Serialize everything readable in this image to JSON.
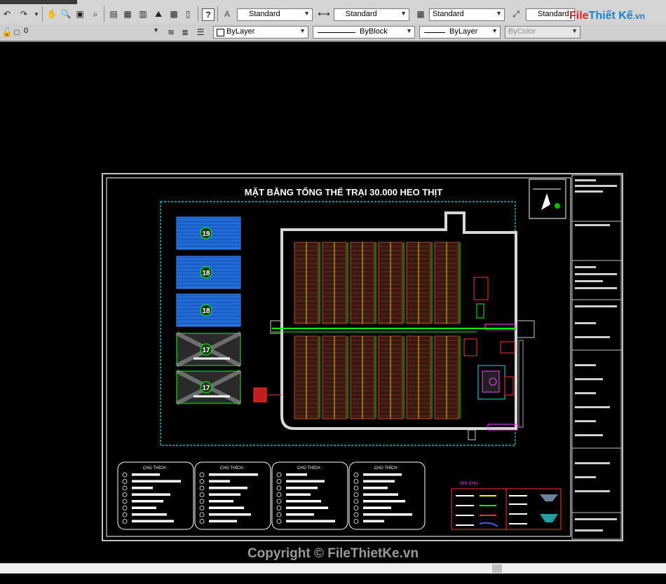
{
  "toolbar": {
    "text_style": "Standard",
    "dim_style": "Standard",
    "table_style": "Standard",
    "multileader_style": "Standard",
    "layer": "0",
    "color": "ByLayer",
    "linetype": "ByBlock",
    "lineweight": "ByLayer",
    "plotstyle": "ByColor"
  },
  "logo": {
    "part1": "File",
    "part2": "Thiết Kế",
    "part3": ".vn"
  },
  "drawing": {
    "title": "MẶT BẰNG TỔNG THỂ TRẠI 30.000 HEO THỊT",
    "blocks": [
      {
        "num": "19"
      },
      {
        "num": "18"
      },
      {
        "num": "18"
      },
      {
        "num": "17"
      },
      {
        "num": "17"
      }
    ],
    "legend_headers": [
      "CHÚ THÍCH :",
      "CHÚ THÍCH :",
      "CHÚ THÍCH :",
      "CHÚ THÍCH :"
    ],
    "notes_title": "GHI CHÚ"
  },
  "watermark": "Copyright © FileThietKe.vn",
  "colors": {
    "border": "#ffffff",
    "site": "#00e6e6",
    "green": "#00ff00",
    "blue_field": "#1860c8",
    "barn": "#c05030",
    "red": "#ff3030",
    "magenta": "#ff40ff",
    "yellow": "#ffff00"
  }
}
